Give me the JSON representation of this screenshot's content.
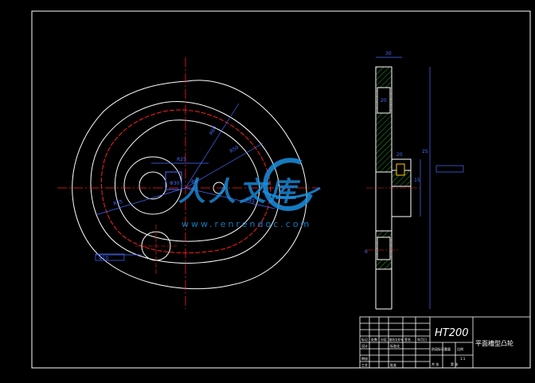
{
  "title_block": {
    "material": "HT200",
    "part_name": "平面槽型凸轮",
    "labels": [
      "标记",
      "处数",
      "分区",
      "更改文件号",
      "签名",
      "年月日",
      "设计",
      "标准化",
      "审核",
      "工艺",
      "批准",
      "阶段标记",
      "重量",
      "比例",
      "共 张",
      "第 张"
    ],
    "scale": "1:1"
  },
  "dimensions": {
    "front": [
      "R60",
      "R50",
      "R45",
      "R35",
      "R25",
      "Φ30",
      "Φ10",
      "80"
    ],
    "side": [
      "30",
      "20",
      "20",
      "15",
      "25",
      "6"
    ]
  },
  "watermark": {
    "brand": "人人文库",
    "url": "www.renrendoc.com"
  },
  "colors": {
    "background": "#000000",
    "line": "#ffffff",
    "center": "#ff2020",
    "dimension": "#3355ff",
    "hatch": "#33cc33",
    "watermark": "#1a8fe0"
  }
}
